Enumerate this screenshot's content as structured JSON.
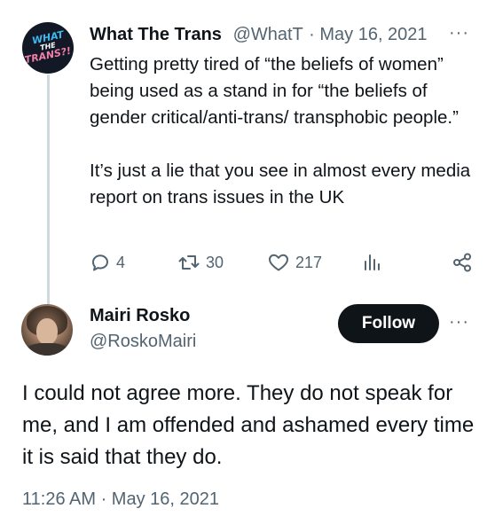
{
  "quoted_tweet": {
    "avatar_text": [
      "WHAT",
      "THE",
      "TRANS?!"
    ],
    "display_name": "What The Trans",
    "handle": "@WhatT",
    "separator": "·",
    "date": "May 16, 2021",
    "more_icon": "···",
    "paragraphs": [
      "Getting pretty tired of “the beliefs of women” being used as a stand in for “the beliefs of gender critical/anti-trans/ transphobic people.”",
      "It’s just a lie that you see in almost every media report on trans issues in the UK"
    ],
    "actions": {
      "reply_count": "4",
      "retweet_count": "30",
      "like_count": "217"
    }
  },
  "main_tweet": {
    "display_name": "Mairi Rosko",
    "handle": "@RoskoMairi",
    "follow_label": "Follow",
    "more_icon": "···",
    "text": "I could not agree more. They do not speak for me, and I am offended and ashamed every time it is said that they do.",
    "timestamp": "11:26 AM · May 16, 2021"
  },
  "colors": {
    "text": "#0f1419",
    "secondary": "#536471",
    "thread_line": "#cfd9de",
    "follow_bg": "#0f1419"
  },
  "icons": [
    "reply-icon",
    "retweet-icon",
    "like-icon",
    "views-icon",
    "share-icon",
    "more-icon"
  ]
}
